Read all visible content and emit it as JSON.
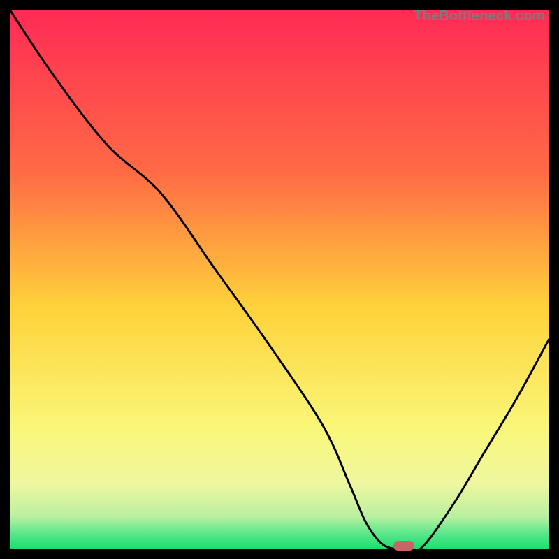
{
  "watermark": "TheBottleneck.com",
  "colors": {
    "top": "#ff2a55",
    "mid_upper": "#ff8a3a",
    "mid": "#ffd93a",
    "mid_lower": "#f6f98a",
    "bottom": "#18e06b",
    "line": "#000000",
    "marker": "#c76666",
    "frame": "#000000"
  },
  "chart_data": {
    "type": "line",
    "title": "",
    "xlabel": "",
    "ylabel": "",
    "xlim": [
      0,
      100
    ],
    "ylim": [
      0,
      100
    ],
    "grid": false,
    "legend": null,
    "series": [
      {
        "name": "bottleneck-curve",
        "x": [
          0,
          8,
          18,
          28,
          38,
          48,
          58,
          63,
          66,
          69,
          72,
          76,
          82,
          88,
          94,
          100
        ],
        "y": [
          100,
          88,
          75,
          66,
          52,
          38,
          23,
          12,
          5,
          1,
          0,
          0,
          8,
          18,
          28,
          39
        ]
      }
    ],
    "annotations": [
      {
        "name": "optimal-marker",
        "x": 73,
        "y": 0.6
      }
    ],
    "gradient_stops": [
      {
        "pos": 0.0,
        "color": "#ff2a55"
      },
      {
        "pos": 0.3,
        "color": "#ff6a45"
      },
      {
        "pos": 0.55,
        "color": "#ffd23a"
      },
      {
        "pos": 0.78,
        "color": "#f9f77a"
      },
      {
        "pos": 0.88,
        "color": "#eef7a0"
      },
      {
        "pos": 0.94,
        "color": "#b8f0a0"
      },
      {
        "pos": 0.975,
        "color": "#4fe588"
      },
      {
        "pos": 1.0,
        "color": "#18e06b"
      }
    ]
  }
}
